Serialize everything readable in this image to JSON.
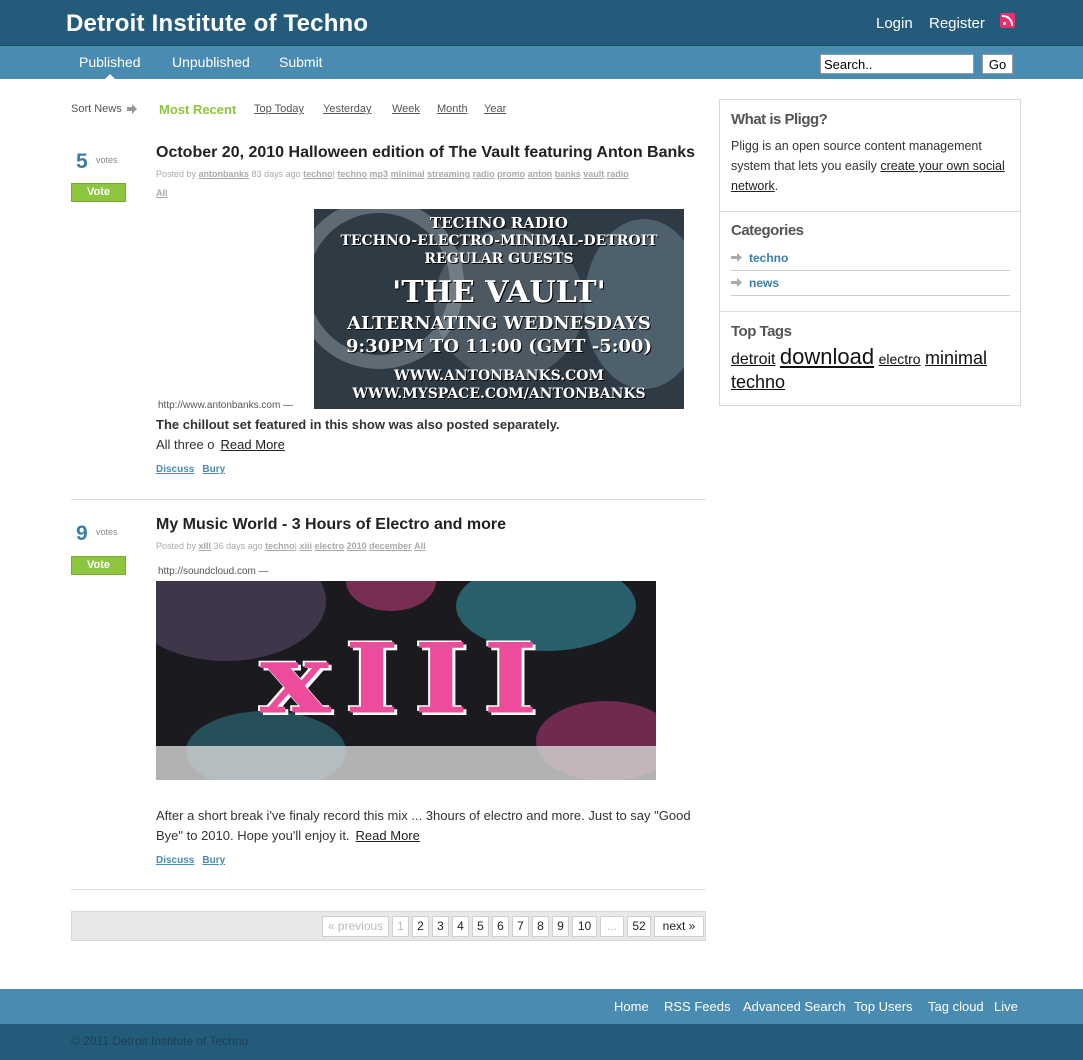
{
  "header": {
    "site_title": "Detroit Institute of Techno",
    "login": "Login",
    "register": "Register"
  },
  "nav": {
    "tabs": [
      {
        "label": "Published",
        "active": true
      },
      {
        "label": "Unpublished",
        "active": false
      },
      {
        "label": "Submit",
        "active": false
      }
    ],
    "search_value": "Search..",
    "go_label": "Go"
  },
  "sort": {
    "label": "Sort News",
    "current": "Most Recent",
    "options": [
      "Top Today",
      "Yesterday",
      "Week",
      "Month",
      "Year"
    ]
  },
  "stories": [
    {
      "votes": "5",
      "votes_label": "votes",
      "vote_button": "Vote",
      "title": "October 20, 2010 Halloween edition of The Vault featuring Anton Banks",
      "meta_prefix": "Posted by",
      "author": "antonbanks",
      "age": "83 days ago",
      "category": "techno",
      "tags": [
        "techno",
        "mp3",
        "minimal",
        "streaming",
        "radio",
        "promo",
        "anton",
        "banks",
        "vault",
        "radio"
      ],
      "all_label": "All",
      "source_url": "http://www.antonbanks.com —",
      "image_lines": [
        "TECHNO RADIO",
        "TECHNO-ELECTRO-MINIMAL-DETROIT",
        "REGULAR GUESTS",
        "'THE VAULT'",
        "ALTERNATING WEDNESDAYS",
        "9:30PM TO 11:00 (GMT -5:00)",
        "WWW.ANTONBANKS.COM",
        "WWW.MYSPACE.COM/ANTONBANKS"
      ],
      "body_bold": "The chillout set featured in this show was also posted separately.",
      "body_text": "All three o",
      "read_more": "Read More",
      "discuss": "Discuss",
      "bury": "Bury"
    },
    {
      "votes": "9",
      "votes_label": "votes",
      "vote_button": "Vote",
      "title": "My Music World - 3 Hours of Electro and more",
      "meta_prefix": "Posted by",
      "author": "xIII",
      "age": "36 days ago",
      "category": "techno",
      "tags": [
        "xiii",
        "electro",
        "2010",
        "december"
      ],
      "all_label": "All",
      "source_url": "http://soundcloud.com —",
      "image_text": "xIII",
      "body_line1": "After a short break i've finaly record this mix ... 3hours of electro and more. Just to say \"Good",
      "body_line2": "Bye\" to 2010. Hope you'll enjoy it.",
      "read_more": "Read More",
      "discuss": "Discuss",
      "bury": "Bury"
    }
  ],
  "pagination": {
    "previous": "« previous",
    "pages": [
      "1",
      "2",
      "3",
      "4",
      "5",
      "6",
      "7",
      "8",
      "9",
      "10"
    ],
    "ellipsis": "...",
    "last": "52",
    "next": "next »"
  },
  "sidebar": {
    "about_title": "What is Pligg?",
    "about_text": "Pligg is an open source content management system that lets you easily",
    "about_link": "create your own social network",
    "about_end": ".",
    "categories_title": "Categories",
    "categories": [
      "techno",
      "news"
    ],
    "tags_title": "Top Tags",
    "tags": [
      "detroit",
      "download",
      "electro",
      "minimal",
      "techno"
    ]
  },
  "footer": {
    "links": [
      "Home",
      "RSS Feeds",
      "Advanced Search",
      "Top Users",
      "Tag cloud",
      "Live"
    ],
    "copyright": "© 2011 Detroit Institute of Techno"
  },
  "colors": {
    "header_dark": "#245b7a",
    "header_light": "#4a8bb2",
    "vote_green": "#8cc63f",
    "link_blue": "#3b7ea8"
  }
}
